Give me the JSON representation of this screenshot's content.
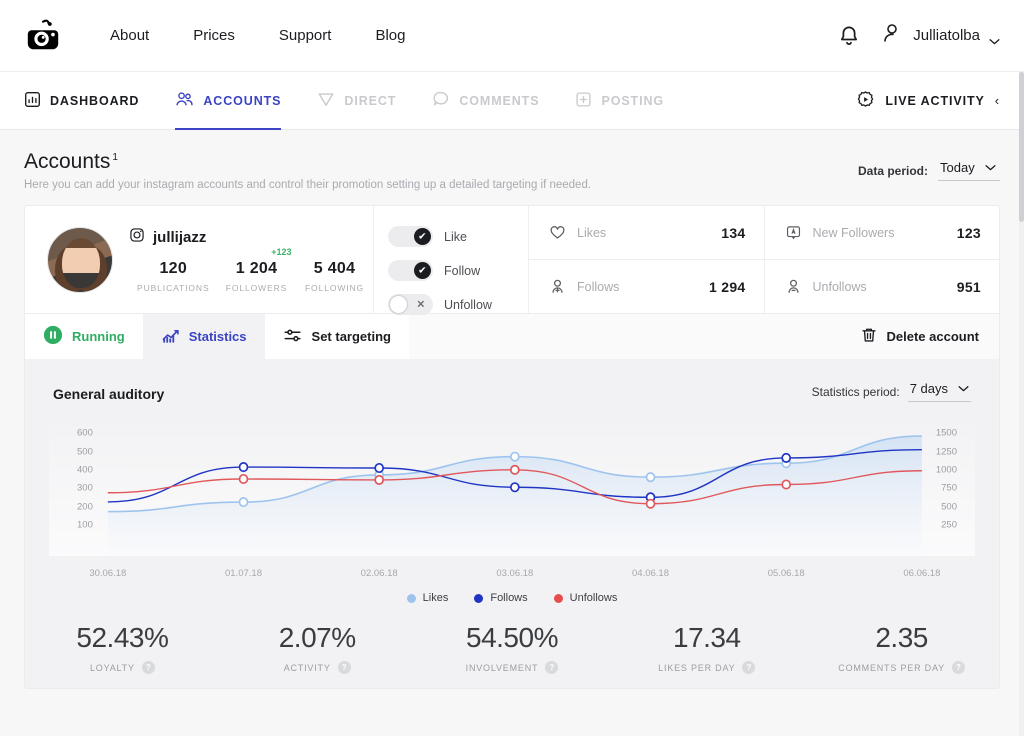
{
  "header": {
    "logo_icon": "camera-robot-logo",
    "nav": [
      {
        "label": "About"
      },
      {
        "label": "Prices"
      },
      {
        "label": "Support"
      },
      {
        "label": "Blog"
      }
    ],
    "bell_icon": "notification-bell-icon",
    "user_icon": "user-avatar-icon",
    "user_name": "Julliatolba",
    "caret_icon": "chevron-down-icon"
  },
  "subnav": {
    "items": [
      {
        "label": "DASHBOARD",
        "icon": "dashboard-chart-icon",
        "state": "dark"
      },
      {
        "label": "ACCOUNTS",
        "icon": "accounts-people-icon",
        "state": "active"
      },
      {
        "label": "DIRECT",
        "icon": "send-paperplane-icon",
        "state": "muted"
      },
      {
        "label": "COMMENTS",
        "icon": "comment-bubble-icon",
        "state": "muted"
      },
      {
        "label": "POSTING",
        "icon": "plus-square-icon",
        "state": "muted"
      }
    ],
    "live_activity": {
      "label": "LIVE ACTIVITY",
      "icon": "gear-play-icon",
      "chevron": "‹"
    }
  },
  "page": {
    "title": "Accounts",
    "title_sup": "1",
    "subtitle": "Here you can add your instagram accounts and control their promotion setting up a detailed targeting if needed.",
    "data_period_label": "Data period:",
    "data_period_value": "Today"
  },
  "account": {
    "instagram_icon": "instagram-icon",
    "handle": "jullijazz",
    "stats": [
      {
        "value": "120",
        "label": "PUBLICATIONS",
        "delta": ""
      },
      {
        "value": "1 204",
        "label": "FOLLOWERS",
        "delta": "+123"
      },
      {
        "value": "5 404",
        "label": "FOLLOWING",
        "delta": ""
      }
    ],
    "toggles": [
      {
        "label": "Like",
        "on": true,
        "mark": "✔"
      },
      {
        "label": "Follow",
        "on": true,
        "mark": "✔"
      },
      {
        "label": "Unfollow",
        "on": false,
        "mark": "✕"
      }
    ],
    "metrics": [
      {
        "label": "Likes",
        "value": "134",
        "icon": "heart-icon"
      },
      {
        "label": "New Followers",
        "value": "123",
        "icon": "new-follower-badge-icon"
      },
      {
        "label": "Follows",
        "value": "1 294",
        "icon": "person-add-icon"
      },
      {
        "label": "Unfollows",
        "value": "951",
        "icon": "person-remove-icon"
      }
    ],
    "tabs": [
      {
        "label": "Running",
        "icon": "pause-circle-icon",
        "kind": "running",
        "selected": true
      },
      {
        "label": "Statistics",
        "icon": "bar-chart-icon",
        "kind": "stats",
        "selected": false
      },
      {
        "label": "Set targeting",
        "icon": "sliders-icon",
        "kind": "plain",
        "selected": true
      }
    ],
    "delete_label": "Delete account",
    "delete_icon": "trash-icon"
  },
  "chart_header": {
    "title": "General auditory",
    "period_label": "Statistics period:",
    "period_value": "7 days"
  },
  "chart_data": {
    "type": "line",
    "title": "General auditory",
    "xlabel": "",
    "ylabel": "",
    "grid": false,
    "legend_position": "bottom-center",
    "categories": [
      "30.06.18",
      "01.07.18",
      "02.06.18",
      "03.06.18",
      "04.06.18",
      "05.06.18",
      "06.06.18"
    ],
    "y_left_ticks": [
      600,
      500,
      400,
      300,
      200,
      100
    ],
    "y_right_ticks": [
      1500,
      1250,
      1000,
      750,
      500,
      250
    ],
    "ylim_left": [
      50,
      650
    ],
    "ylim_right": [
      125,
      1625
    ],
    "series": [
      {
        "name": "Likes",
        "color": "#9ec4ee",
        "axis": "right",
        "values": [
          430,
          560,
          930,
          1180,
          900,
          1090,
          1460
        ]
      },
      {
        "name": "Follows",
        "color": "#2035c4",
        "axis": "left",
        "values": [
          225,
          415,
          410,
          305,
          250,
          465,
          510
        ]
      },
      {
        "name": "Unfollows",
        "color": "#e0585b",
        "axis": "left",
        "values": [
          275,
          350,
          345,
          400,
          215,
          320,
          395
        ]
      }
    ],
    "legend": [
      {
        "label": "Likes",
        "color": "#9ec4ee"
      },
      {
        "label": "Follows",
        "color": "#2035c4"
      },
      {
        "label": "Unfollows",
        "color": "#e84c4c"
      }
    ]
  },
  "kpis": [
    {
      "value": "52.43%",
      "label": "LOYALTY",
      "help": "?"
    },
    {
      "value": "2.07%",
      "label": "ACTIVITY",
      "help": "?"
    },
    {
      "value": "54.50%",
      "label": "INVOLVEMENT",
      "help": "?"
    },
    {
      "value": "17.34",
      "label": "LIKES PER DAY",
      "help": "?"
    },
    {
      "value": "2.35",
      "label": "COMMENTS PER DAY",
      "help": "?"
    }
  ],
  "colors": {
    "accent": "#3b44c4",
    "running_green": "#2fae63",
    "delta_green": "#3ab36b",
    "likes": "#9ec4ee",
    "follows": "#2035c4",
    "unfollows": "#e84c4c"
  }
}
